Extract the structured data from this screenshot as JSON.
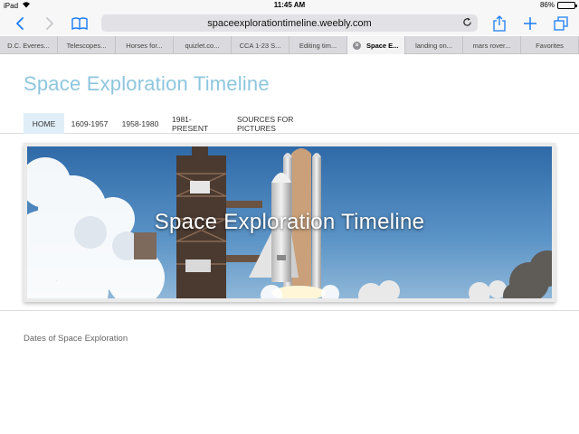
{
  "status_bar": {
    "device": "iPad",
    "time": "11:45 AM",
    "battery": "86%",
    "battery_level": 0.86
  },
  "toolbar": {
    "url": "spaceexplorationtimeline.weebly.com",
    "icons": [
      "back-icon",
      "forward-icon",
      "bookmarks-icon",
      "reload-icon",
      "share-icon",
      "new-tab-icon",
      "tabs-icon"
    ]
  },
  "tabs": [
    {
      "label": "D.C. Everes..."
    },
    {
      "label": "Telescopes..."
    },
    {
      "label": "Horses for..."
    },
    {
      "label": "quizlet.co..."
    },
    {
      "label": "CCA 1-23 S..."
    },
    {
      "label": "Editing tim..."
    },
    {
      "label": "Space E...",
      "active": true
    },
    {
      "label": "landing on..."
    },
    {
      "label": "mars rover..."
    },
    {
      "label": "Favorites"
    }
  ],
  "page": {
    "site_title": "Space Exploration Timeline",
    "nav": [
      {
        "label": "HOME",
        "active": true
      },
      {
        "label": "1609-1957"
      },
      {
        "label": "1958-1980"
      },
      {
        "label": "1981-PRESENT"
      },
      {
        "label": "SOURCES FOR PICTURES"
      }
    ],
    "banner_title": "Space Exploration Timeline",
    "body_text": "Dates of Space Exploration"
  },
  "colors": {
    "accent": "#1a7cf5",
    "title": "#8ec6df",
    "nav_active": "#e0eef7"
  }
}
